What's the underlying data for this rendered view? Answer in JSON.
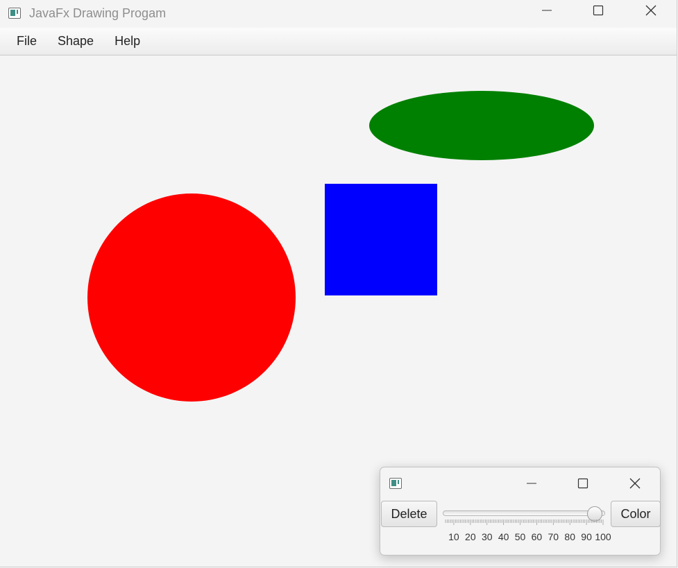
{
  "main_window": {
    "title": "JavaFx Drawing Progam",
    "icon": "app-window-icon",
    "controls": [
      "minimize-icon",
      "maximize-icon",
      "close-icon"
    ]
  },
  "menubar": {
    "items": [
      {
        "label": "File"
      },
      {
        "label": "Shape"
      },
      {
        "label": "Help"
      }
    ]
  },
  "canvas": {
    "shapes": [
      {
        "type": "ellipse",
        "color": "#008000"
      },
      {
        "type": "rectangle",
        "color": "#0000ff"
      },
      {
        "type": "circle",
        "color": "#ff0000"
      }
    ]
  },
  "tool_window": {
    "icon": "app-window-icon",
    "controls": [
      "minimize-icon",
      "maximize-icon",
      "close-icon"
    ],
    "delete_label": "Delete",
    "color_label": "Color",
    "slider": {
      "value": 95,
      "min": 5,
      "max": 100,
      "tick_labels": [
        "10",
        "20",
        "30",
        "40",
        "50",
        "60",
        "70",
        "80",
        "90",
        "100"
      ]
    }
  }
}
